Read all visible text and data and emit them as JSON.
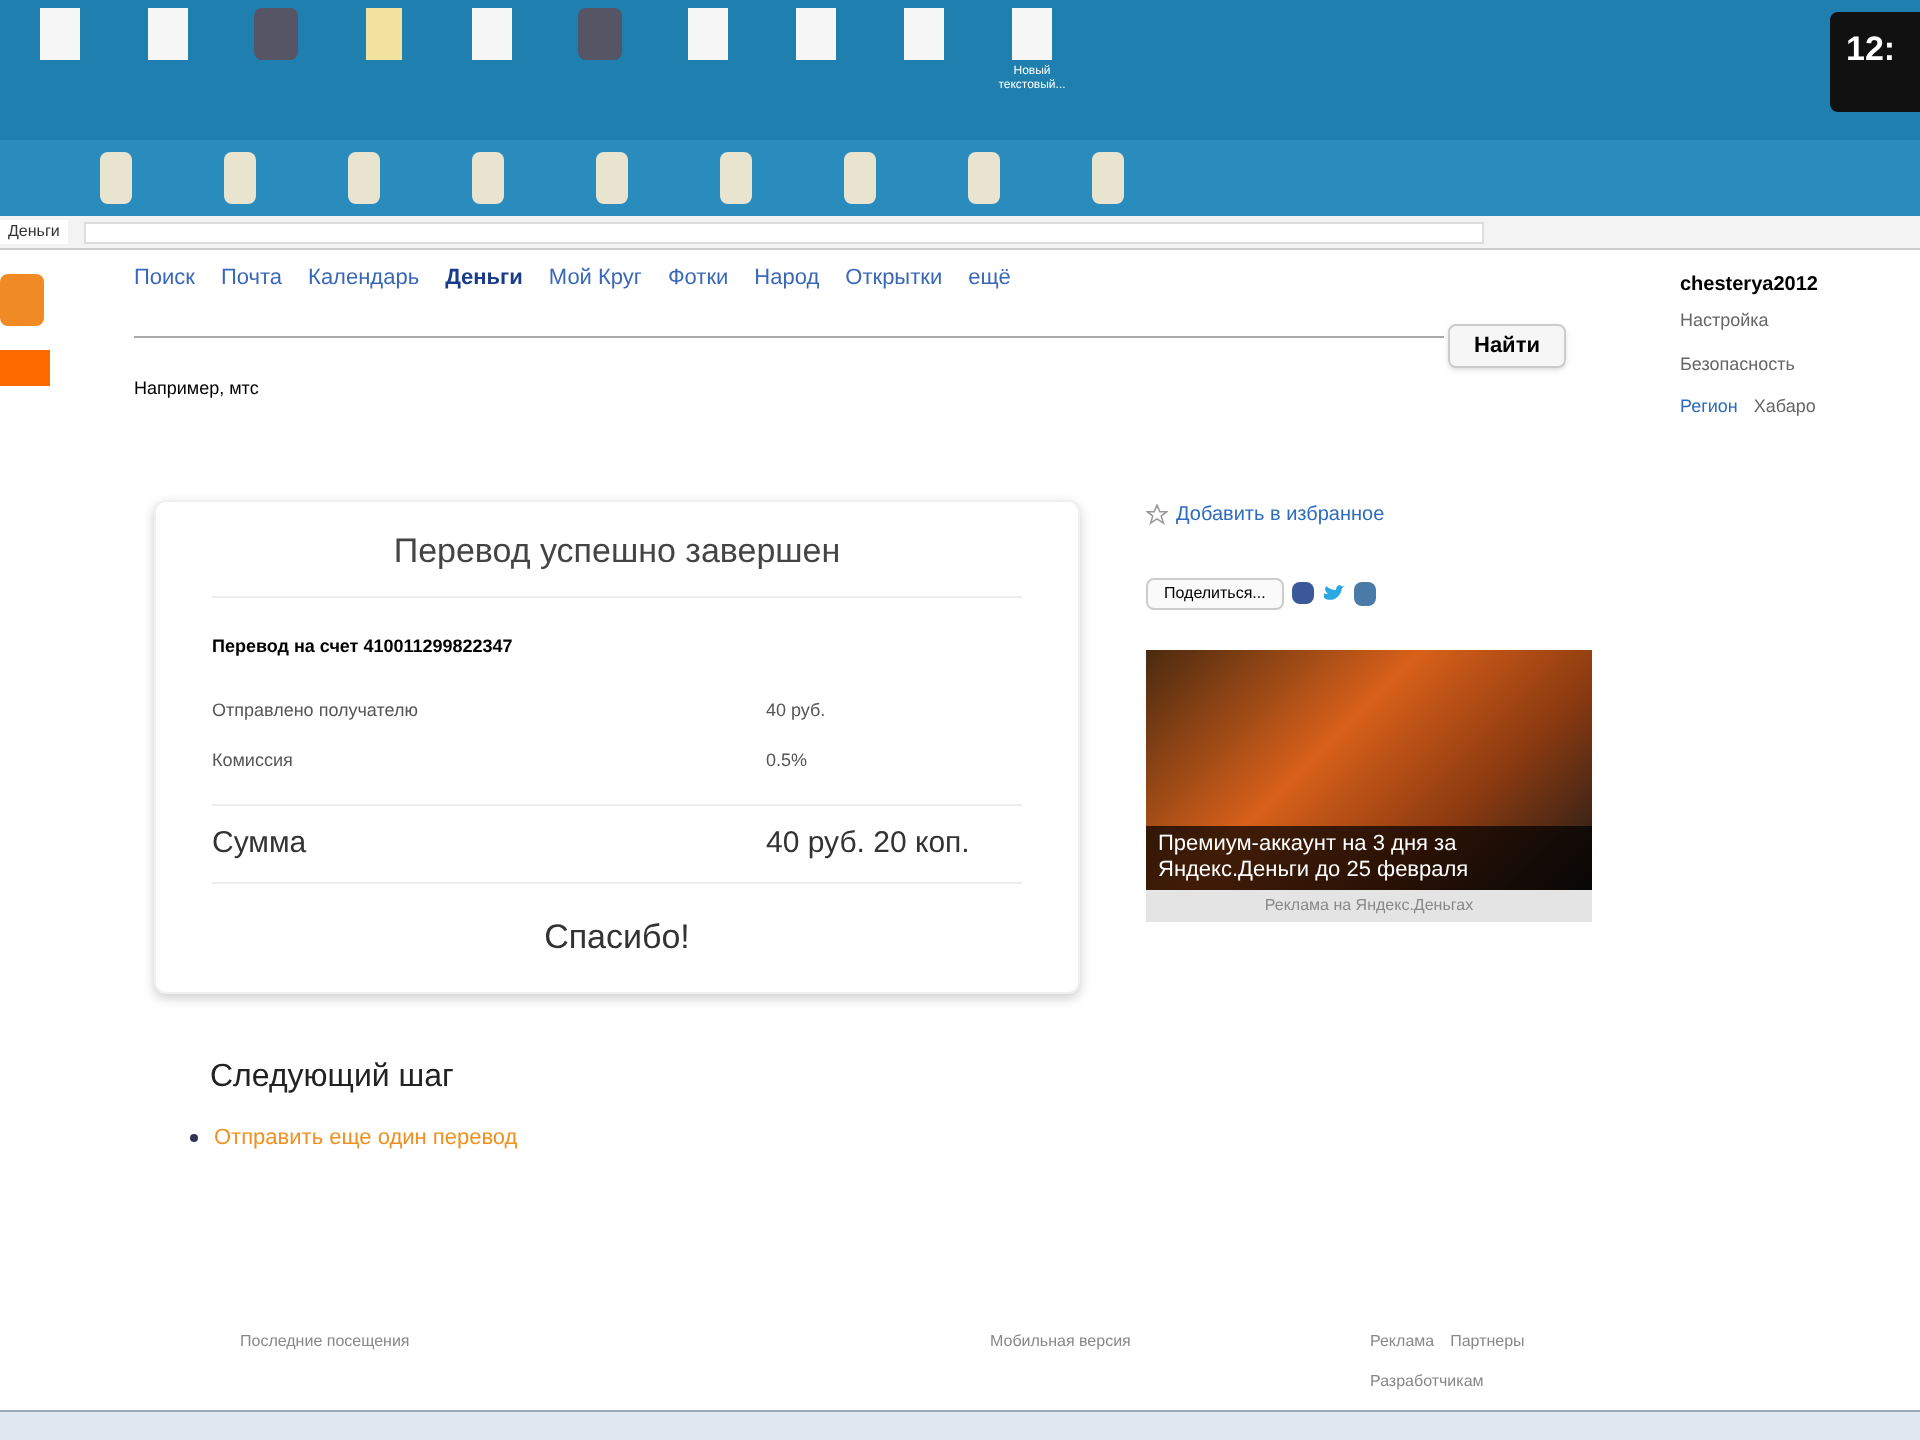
{
  "desktop": {
    "icons": [
      {
        "kind": "file"
      },
      {
        "kind": "file"
      },
      {
        "kind": "image"
      },
      {
        "kind": "folder"
      },
      {
        "kind": "file"
      },
      {
        "kind": "image"
      },
      {
        "kind": "file"
      },
      {
        "kind": "file"
      },
      {
        "kind": "file"
      },
      {
        "kind": "file",
        "label": "Новый текстовый..."
      }
    ],
    "clock": "12:"
  },
  "browser": {
    "tab": "Деньги"
  },
  "nav": [
    {
      "label": "Поиск",
      "selected": false
    },
    {
      "label": "Почта",
      "selected": false
    },
    {
      "label": "Календарь",
      "selected": false
    },
    {
      "label": "Деньги",
      "selected": true
    },
    {
      "label": "Мой Круг",
      "selected": false
    },
    {
      "label": "Фотки",
      "selected": false
    },
    {
      "label": "Народ",
      "selected": false
    },
    {
      "label": "Открытки",
      "selected": false
    },
    {
      "label": "ещё",
      "selected": false
    }
  ],
  "search": {
    "button": "Найти",
    "hint": "Например, мтс"
  },
  "user": {
    "name": "chesterya2012",
    "links": [
      "Настройка",
      "Безопасность"
    ],
    "region_label": "Регион",
    "region": "Хабаро"
  },
  "receipt": {
    "title": "Перевод успешно завершен",
    "account": "Перевод на счет 410011299822347",
    "rows": [
      {
        "label": "Отправлено получателю",
        "value": "40 руб."
      },
      {
        "label": "Комиссия",
        "value": "0.5%"
      }
    ],
    "total_label": "Сумма",
    "total": "40 руб. 20 коп.",
    "thanks": "Спасибо!"
  },
  "next": {
    "title": "Следующий шаг",
    "link": "Отправить еще один перевод"
  },
  "aside": {
    "favorite": "Добавить в избранное",
    "share": "Поделиться...",
    "ad_text": "Премиум-аккаунт на 3 дня за Яндекс.Деньги до 25 февраля",
    "ad_caption": "Реклама на Яндекс.Деньгах"
  },
  "footer": {
    "col_1": [
      "Последние посещения"
    ],
    "col_2": [
      "Мобильная версия"
    ],
    "col_3": [
      "Реклама",
      "Партнеры",
      "Разработчикам"
    ]
  }
}
